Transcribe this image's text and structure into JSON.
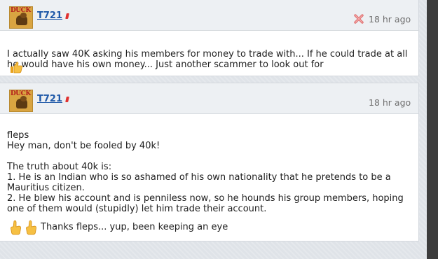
{
  "posts": [
    {
      "username": "T721",
      "timestamp": "18 hr ago",
      "body": "I actually saw 40K asking his members for money to trade with... If he could trade at all he would have his own money... Just another scammer to look out for",
      "avatar_label": "DUCK",
      "icons": [
        "flag-icon",
        "delete-icon",
        "thumbs-up-icon"
      ]
    },
    {
      "username": "T721",
      "timestamp": "18 hr ago",
      "body": "fleps\nHey man, don't be fooled by 40k!\n\nThe truth about 40k is:\n1. He is an Indian who is so ashamed of his own nationality that he pretends to be a Mauritius citizen.\n2. He blew his account and is penniless now, so he hounds his group members, hoping one of them would (stupidly) let him trade their account.",
      "avatar_label": "DUCK",
      "thanks_text": "Thanks fleps... yup, been keeping an eye",
      "icons": [
        "flag-icon",
        "pointing-hand-icon"
      ]
    }
  ],
  "colors": {
    "username": "#1e58a8",
    "header_bg": "#edf0f3",
    "page_bg": "#dfe3e8",
    "delete": "#e07070"
  }
}
